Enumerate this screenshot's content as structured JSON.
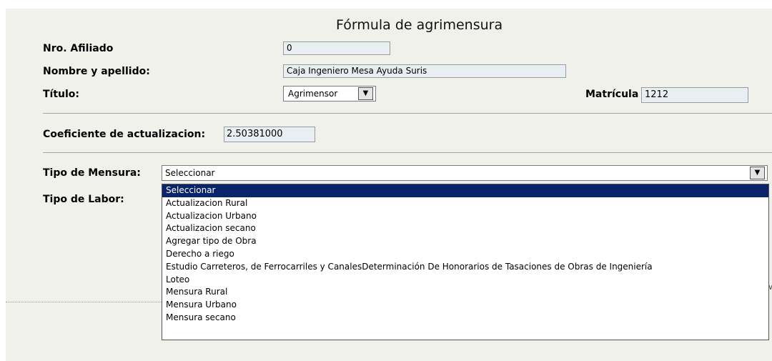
{
  "form": {
    "title": "Fórmula de agrimensura",
    "afiliado_label": "Nro. Afiliado",
    "afiliado_value": "0",
    "nombre_label": "Nombre y apellido:",
    "nombre_value": "Caja Ingeniero Mesa Ayuda Suris",
    "titulo_label": "Título:",
    "titulo_selected": "Agrimensor",
    "matricula_label": "Matrícula",
    "matricula_value": "1212",
    "coef_label": "Coeficiente de actualizacion:",
    "coef_value": "2.50381000",
    "tipo_mensura_label": "Tipo de Mensura:",
    "tipo_mensura_selected": "Seleccionar",
    "tipo_labor_label": "Tipo de Labor:"
  },
  "dropdown": {
    "options": [
      "Seleccionar",
      "Actualizacion Rural",
      "Actualizacion Urbano",
      "Actualizacion secano",
      "Agregar tipo de Obra",
      "Derecho a riego",
      "Estudio Carreteros, de Ferrocarriles y CanalesDeterminación De Honorarios de Tasaciones de Obras de Ingeniería",
      "Loteo",
      "Mensura Rural",
      "Mensura Urbano",
      "Mensura secano"
    ],
    "highlighted_index": 0
  },
  "icons": {
    "dropdown_arrow": "chevron-down-icon"
  },
  "colors": {
    "panel_bg": "#f1f1ec",
    "field_bg": "#e9eef3",
    "highlight": "#0a246a"
  }
}
